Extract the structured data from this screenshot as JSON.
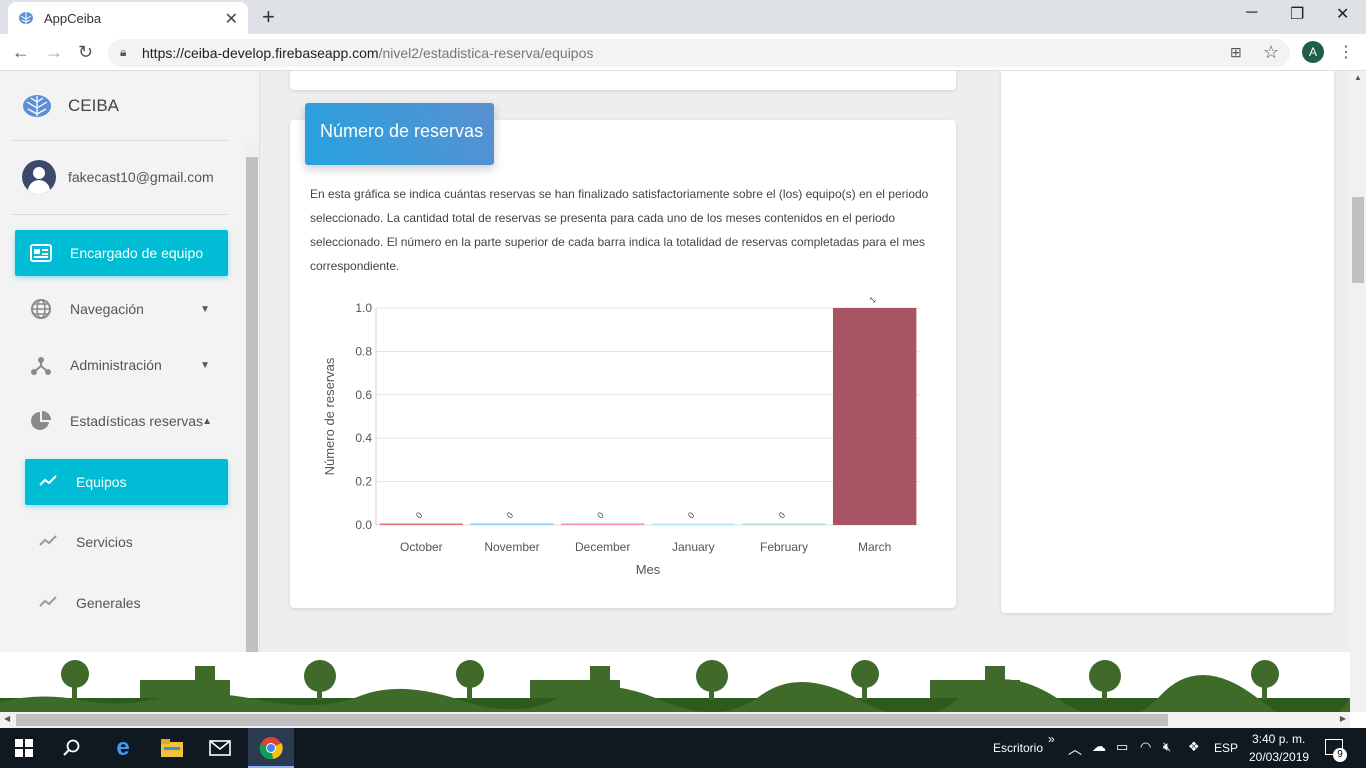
{
  "browser": {
    "tab_title": "AppCeiba",
    "url_host": "https://ceiba-develop.firebaseapp.com",
    "url_path": "/nivel2/estadistica-reserva/equipos",
    "profile_initial": "A"
  },
  "sidebar": {
    "app_name": "CEIBA",
    "user_email": "fakecast10@gmail.com",
    "items": [
      {
        "label": "Encargado de equipo",
        "icon": "newspaper-icon"
      },
      {
        "label": "Navegación",
        "icon": "globe-icon"
      },
      {
        "label": "Administración",
        "icon": "network-icon"
      },
      {
        "label": "Estadísticas reservas",
        "icon": "pie-chart-icon"
      }
    ],
    "subitems": [
      {
        "label": "Equipos",
        "icon": "trending-icon"
      },
      {
        "label": "Servicios",
        "icon": "trending-icon"
      },
      {
        "label": "Generales",
        "icon": "trending-icon"
      }
    ]
  },
  "card": {
    "header": "Número de reservas",
    "description": "En esta gráfica se indica cuántas reservas se han finalizado satisfactoriamente sobre el (los) equipo(s) en el periodo seleccionado. La cantidad total de reservas se presenta para cada uno de los meses contenidos en el periodo seleccionado. El número en la parte superior de cada barra indica la totalidad de reservas completadas para el mes correspondiente."
  },
  "chart_data": {
    "type": "bar",
    "categories": [
      "October",
      "November",
      "December",
      "January",
      "February",
      "March"
    ],
    "values": [
      0,
      0,
      0,
      0,
      0,
      1
    ],
    "data_labels": [
      "0",
      "0",
      "0",
      "0",
      "0",
      "1"
    ],
    "colors": [
      "#e57373",
      "#90caf9",
      "#f48fb1",
      "#b3e5fc",
      "#b2dfdb",
      "#a85462"
    ],
    "xlabel": "Mes",
    "ylabel": "Número de reservas",
    "ylim": [
      0,
      1.0
    ],
    "yticks": [
      "0.0",
      "0.2",
      "0.4",
      "0.6",
      "0.8",
      "1.0"
    ],
    "grid": true
  },
  "taskbar": {
    "desktop_label": "Escritorio",
    "lang": "ESP",
    "time": "3:40 p. m.",
    "date": "20/03/2019",
    "notifications": "9"
  }
}
